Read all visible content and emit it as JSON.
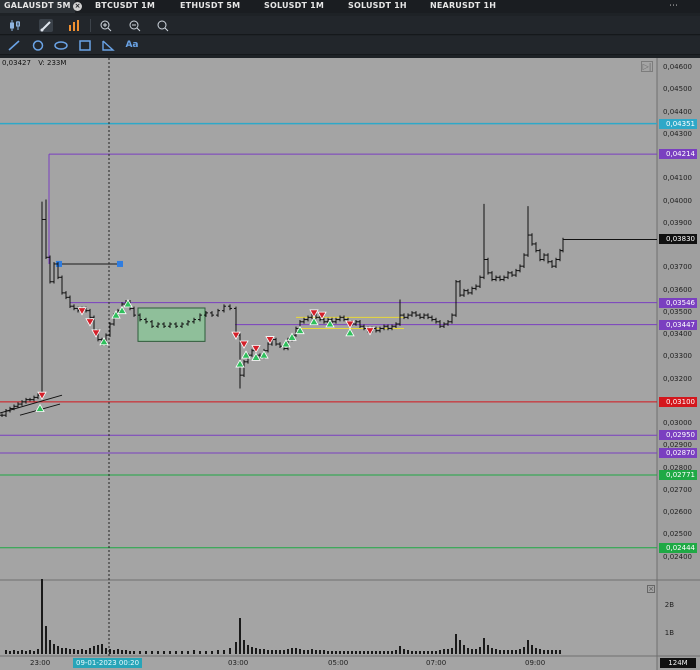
{
  "tabs": [
    {
      "label": "GALAUSDT 5M",
      "active": true
    },
    {
      "label": "BTCUSDT 1M",
      "active": false
    },
    {
      "label": "ETHUSDT 5M",
      "active": false
    },
    {
      "label": "SOLUSDT 1M",
      "active": false
    },
    {
      "label": "SOLUSDT 1H",
      "active": false
    },
    {
      "label": "NEARUSDT 1H",
      "active": false
    }
  ],
  "tab_close_glyph": "×",
  "tab_more_glyph": "⋯",
  "toolbar": {
    "row1": [
      "candles-icon",
      "brush-icon",
      "bar-chart-icon",
      "zoom-in-icon",
      "zoom-out-icon",
      "search-icon"
    ],
    "row2": [
      "trend-line-icon",
      "circle-icon",
      "ellipse-icon",
      "rectangle-icon",
      "triangle-icon",
      "text-tool-icon"
    ],
    "text_tool_label": "Aa"
  },
  "status": {
    "price": "0,03427",
    "volume": "V: 233M"
  },
  "price_axis": [
    "0,04600",
    "0,04500",
    "0,04400",
    "0,04300",
    "0,04100",
    "0,04000",
    "0,03900",
    "0,03700",
    "0,03600",
    "0,03500",
    "0,03400",
    "0,03300",
    "0,03200",
    "0,03000",
    "0,02900",
    "0,02800",
    "0,02700",
    "0,02600",
    "0,02500",
    "0,02400"
  ],
  "level_tags": [
    {
      "label": "0,04351",
      "color": "#2ea8c8"
    },
    {
      "label": "0,04214",
      "color": "#7a3fc0"
    },
    {
      "label": "0,03830",
      "color": "#111111"
    },
    {
      "label": "0,03546",
      "color": "#7a3fc0"
    },
    {
      "label": "0,03447",
      "color": "#7a3fc0"
    },
    {
      "label": "0,03100",
      "color": "#d4161c"
    },
    {
      "label": "0,02950",
      "color": "#7a3fc0"
    },
    {
      "label": "0,02870",
      "color": "#7a3fc0"
    },
    {
      "label": "0,02771",
      "color": "#1fa945"
    },
    {
      "label": "0,02444",
      "color": "#1fa945"
    }
  ],
  "time_axis": [
    "23:00",
    "03:00",
    "05:00",
    "07:00",
    "09:00"
  ],
  "cursor_date": "09-01-2023 00:20",
  "volume_axis": [
    "2B",
    "1B"
  ],
  "volume_value": "124M",
  "corner_glyph": "▷|",
  "vol_close_glyph": "×",
  "colors": {
    "chart_bg": "#a4a4a4",
    "tab_bar": "#1a1d21",
    "toolbar": "#22262b",
    "accent": "#8fb4e0"
  }
}
